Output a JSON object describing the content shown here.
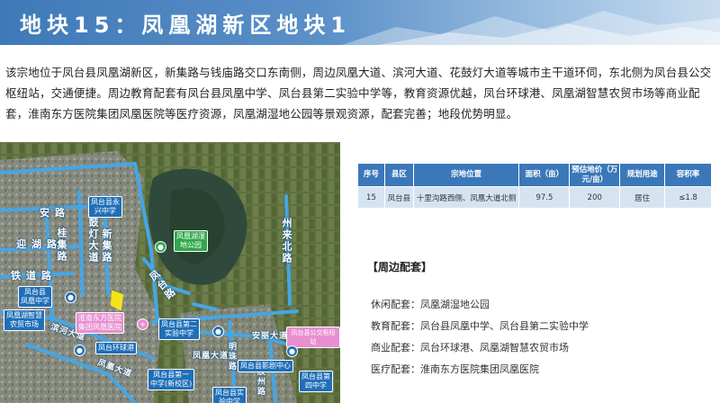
{
  "header": {
    "title": "地块15：凤凰湖新区地块1"
  },
  "intro": "该宗地位于凤台县凤凰湖新区，新集路与钱庙路交口东南侧，周边凤凰大道、滨河大道、花鼓灯大道等城市主干道环伺，东北侧为凤台县公交枢纽站，交通便捷。周边教育配套有凤台县凤凰中学、凤台县第二实验中学等，教育资源优越，凤台环球港、凤凰湖智慧农贸市场等商业配套，淮南东方医院集团凤凰医院等医疗资源，凤凰湖湿地公园等景观资源，配套完善；地段优势明显。",
  "map": {
    "roads": {
      "anlu": "安路",
      "yingcheng": "迎湖路",
      "tielu": "铁道路",
      "gui": "桂集路",
      "huagu": "花鼓灯大道",
      "xinji": "新集路",
      "zhoulai": "州来北路",
      "fengtai": "凤台路",
      "binhe": "滨河大道",
      "anli": "安丽大道",
      "fenghuang": "凤凰大道",
      "mingzhu": "明珠路",
      "jiaozhou": "胶州路",
      "fengfeng": "凤凰大道"
    },
    "pois": {
      "fengtai_school": "凤台县永\n兴中学",
      "park": "凤凰湖湿\n地公园",
      "kindergarten": "凤台县\n凤凰中学",
      "market": "凤凰湖智慧\n农贸市场",
      "hospital": "淮南东方医院\n集团凤凰医院",
      "second_school": "凤台县第二\n实验中学",
      "bus_hub": "凤台县公交枢纽站",
      "mall": "凤台环球港",
      "school_one": "凤台县第一\n中学(新校区)",
      "cultural": "凤台县影剧中心",
      "school_four": "凤台县第\n四中学",
      "experimental": "凤台县实\n验中学"
    }
  },
  "table": {
    "headers": [
      "序号",
      "县区",
      "宗地位置",
      "面积（亩）",
      "预估地价（万元/亩）",
      "规划用途",
      "容积率"
    ],
    "rows": [
      [
        "15",
        "凤台县",
        "十里沟路西侧、凤凰大道北侧",
        "97.5",
        "200",
        "居住",
        "≤1.8"
      ]
    ]
  },
  "amenities": {
    "title": "【周边配套】",
    "items": [
      {
        "label": "休闲配套：",
        "value": "凤凰湖湿地公园"
      },
      {
        "label": "教育配套：",
        "value": "凤台县凤凰中学、凤台县第二实验中学"
      },
      {
        "label": "商业配套：",
        "value": "凤台环球港、凤凰湖智慧农贸市场"
      },
      {
        "label": "医疗配套：",
        "value": "淮南东方医院集团凤凰医院"
      }
    ]
  },
  "colors": {
    "header": "#3f79b8",
    "table_head": "#3b78b9",
    "table_row": "#d6e4f2",
    "road": "#3ea0e0",
    "site": "#f5e31a"
  }
}
